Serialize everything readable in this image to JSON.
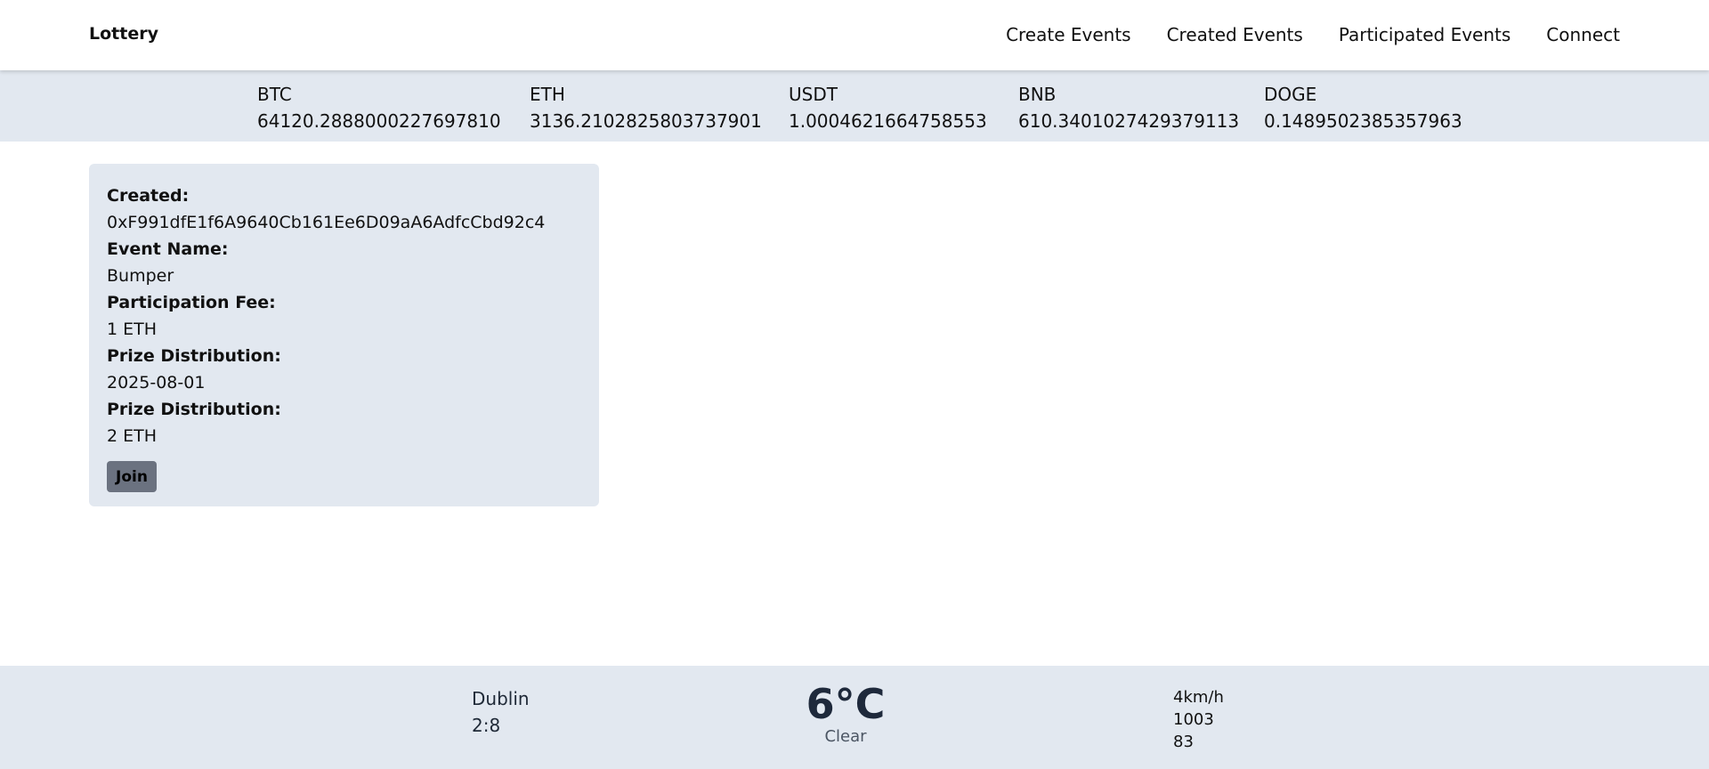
{
  "header": {
    "brand": "Lottery",
    "nav": [
      {
        "label": "Create Events"
      },
      {
        "label": "Created Events"
      },
      {
        "label": "Participated Events"
      },
      {
        "label": "Connect"
      }
    ]
  },
  "ticker": [
    {
      "symbol": "BTC",
      "price": "64120.2888000227697810"
    },
    {
      "symbol": "ETH",
      "price": "3136.2102825803737901"
    },
    {
      "symbol": "USDT",
      "price": "1.0004621664758553"
    },
    {
      "symbol": "BNB",
      "price": "610.3401027429379113"
    },
    {
      "symbol": "DOGE",
      "price": "0.1489502385357963"
    }
  ],
  "event": {
    "created_label": "Created:",
    "created_value": "0xF991dfE1f6A9640Cb161Ee6D09aA6AdfcCbd92c4",
    "name_label": "Event Name:",
    "name_value": "Bumper",
    "fee_label": "Participation Fee:",
    "fee_value": "1 ETH",
    "distribution_label": "Prize Distribution:",
    "distribution_value": "2025-08-01",
    "prize_label": "Prize Distribution:",
    "prize_value": "2 ETH",
    "join_label": "Join"
  },
  "weather": {
    "city": "Dublin",
    "time": "2:8",
    "temperature": "6°C",
    "condition": "Clear",
    "wind": "4km/h",
    "pressure": "1003",
    "humidity": "83"
  }
}
